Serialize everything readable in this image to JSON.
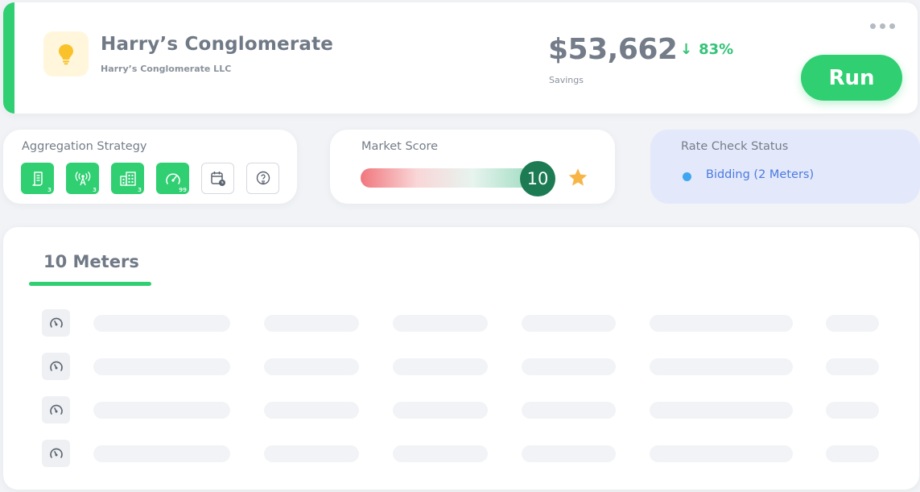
{
  "header": {
    "company_name": "Harry’s Conglomerate",
    "company_legal_name": "Harry’s Conglomerate LLC",
    "savings_value": "$53,662",
    "savings_trend_arrow": "↓",
    "savings_trend_pct": "83%",
    "savings_label": "Savings",
    "run_label": "Run",
    "logo_icon": "lightbulb-icon",
    "colors": {
      "accent": "#2fcf72",
      "trend": "#34c377",
      "logo_bg": "#fff6dc",
      "logo_bulb": "#f9c22b"
    }
  },
  "aggregation": {
    "title": "Aggregation Strategy",
    "chips": [
      {
        "icon": "bill-icon",
        "count": "3",
        "style": "green"
      },
      {
        "icon": "signal-tower-icon",
        "count": "3",
        "style": "green"
      },
      {
        "icon": "building-icon",
        "count": "3",
        "style": "green"
      },
      {
        "icon": "gauge-icon",
        "count": "99",
        "style": "green"
      },
      {
        "icon": "calendar-clock-icon",
        "count": "",
        "style": "outline"
      },
      {
        "icon": "lightbulb-outline-icon",
        "count": "",
        "style": "outline"
      }
    ]
  },
  "market": {
    "title": "Market Score",
    "score": "10",
    "score_icon": "star-icon",
    "colors": {
      "badge": "#1d7b53",
      "star": "#f7b548"
    }
  },
  "rate_check": {
    "title": "Rate Check Status",
    "status_text": "Bidding (2 Meters)",
    "colors": {
      "dot": "#41a6f0",
      "text": "#4a7be0",
      "panel_bg": "#e4e8fb"
    }
  },
  "meters": {
    "tab_label": "10 Meters",
    "row_icon": "meter-gauge-icon",
    "row_count": 4
  }
}
